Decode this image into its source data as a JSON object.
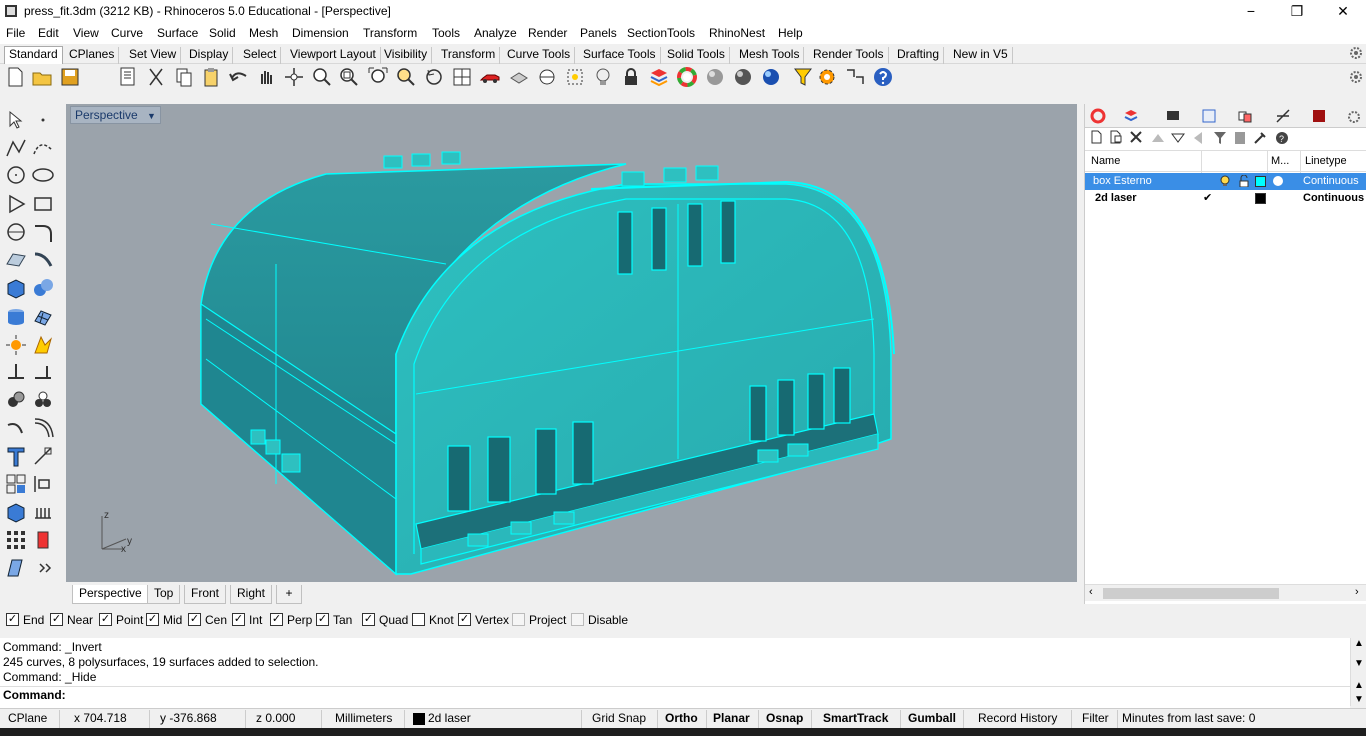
{
  "window": {
    "title": "press_fit.3dm (3212 KB) - Rhinoceros 5.0 Educational - [Perspective]",
    "minimize": "−",
    "maximize": "❐",
    "close": "✕"
  },
  "menu": [
    "File",
    "Edit",
    "View",
    "Curve",
    "Surface",
    "Solid",
    "Mesh",
    "Dimension",
    "Transform",
    "Tools",
    "Analyze",
    "Render",
    "Panels",
    "SectionTools",
    "RhinoNest",
    "Help"
  ],
  "tabs": [
    "Standard",
    "CPlanes",
    "Set View",
    "Display",
    "Select",
    "Viewport Layout",
    "Visibility",
    "Transform",
    "Curve Tools",
    "Surface Tools",
    "Solid Tools",
    "Mesh Tools",
    "Render Tools",
    "Drafting",
    "New in V5"
  ],
  "viewport": {
    "label": "Perspective",
    "dropdown": "▼",
    "axis_z": "z",
    "axis_y": "y",
    "axis_x": "x",
    "model_color": "#1ec9c9",
    "edge_color": "#00ffff"
  },
  "viewport_tabs": [
    "Perspective",
    "Top",
    "Front",
    "Right"
  ],
  "viewport_add": "+",
  "layers": {
    "headers": {
      "name": "Name",
      "material": "M...",
      "linetype": "Linetype"
    },
    "rows": [
      {
        "name": "box Esterno",
        "current": "",
        "linetype": "Continuous",
        "color": "#00ffff",
        "selected": true
      },
      {
        "name": "2d laser",
        "current": "✔",
        "linetype": "Continuous",
        "color": "#000000",
        "selected": false
      }
    ]
  },
  "osnap": [
    {
      "label": "End",
      "checked": true
    },
    {
      "label": "Near",
      "checked": true
    },
    {
      "label": "Point",
      "checked": true
    },
    {
      "label": "Mid",
      "checked": true
    },
    {
      "label": "Cen",
      "checked": true
    },
    {
      "label": "Int",
      "checked": true
    },
    {
      "label": "Perp",
      "checked": true
    },
    {
      "label": "Tan",
      "checked": true
    },
    {
      "label": "Quad",
      "checked": true
    },
    {
      "label": "Knot",
      "checked": false
    },
    {
      "label": "Vertex",
      "checked": true
    },
    {
      "label": "Project",
      "checked": false,
      "disabled": true
    },
    {
      "label": "Disable",
      "checked": false,
      "disabled": true
    }
  ],
  "command": {
    "history": [
      "Command: _Invert",
      "245 curves, 8 polysurfaces, 19 surfaces added to selection.",
      "Command: _Hide"
    ],
    "prompt": "Command:"
  },
  "status": {
    "cplane": "CPlane",
    "x": "x 704.718",
    "y": "y -376.868",
    "z": "z 0.000",
    "units": "Millimeters",
    "layer": "2d laser",
    "grid_snap": "Grid Snap",
    "ortho": "Ortho",
    "planar": "Planar",
    "osnap": "Osnap",
    "smarttrack": "SmartTrack",
    "gumball": "Gumball",
    "record_history": "Record History",
    "filter": "Filter",
    "save_info": "Minutes from last save: 0"
  },
  "toolbar_icons": [
    "new-icon",
    "open-icon",
    "save-icon",
    "print-icon",
    "cut-icon",
    "copy-icon",
    "paste-icon",
    "undo-icon",
    "pan-icon",
    "rotate-view-icon",
    "zoom-dynamic-icon",
    "zoom-window-icon",
    "zoom-extents-icon",
    "zoom-selected-icon",
    "undo-view-icon",
    "four-viewports-icon",
    "car-icon",
    "blocks-icon",
    "cplane-icon",
    "osnap-icon",
    "light-icon",
    "lock-icon",
    "layer-icon",
    "color-wheel-icon",
    "shaded-sphere-icon",
    "rendered-sphere-icon",
    "render-sphere-icon",
    "filter-icon",
    "options-gear-icon",
    "dimension-icon",
    "help-icon"
  ],
  "left_icons": [
    "select-arrow-icon",
    "point-icon",
    "polyline-icon",
    "curve-icon",
    "circle-icon",
    "ellipse-icon",
    "polygon-icon",
    "rectangle-icon",
    "arc-icon",
    "fillet-curve-icon",
    "surface-icon",
    "revolve-icon",
    "box-icon",
    "sphere-icon",
    "cylinder-icon",
    "mesh-icon",
    "explode-icon",
    "boolean-icon",
    "move-icon",
    "scale-icon",
    "group-icon",
    "array-icon",
    "fillet-icon",
    "offset-icon",
    "text-icon",
    "dimension-icon",
    "grid-icon",
    "align-icon",
    "solid-tools-icon",
    "hatch-icon",
    "array-grid-icon",
    "lock-icon",
    "properties-icon",
    "more-icon"
  ]
}
